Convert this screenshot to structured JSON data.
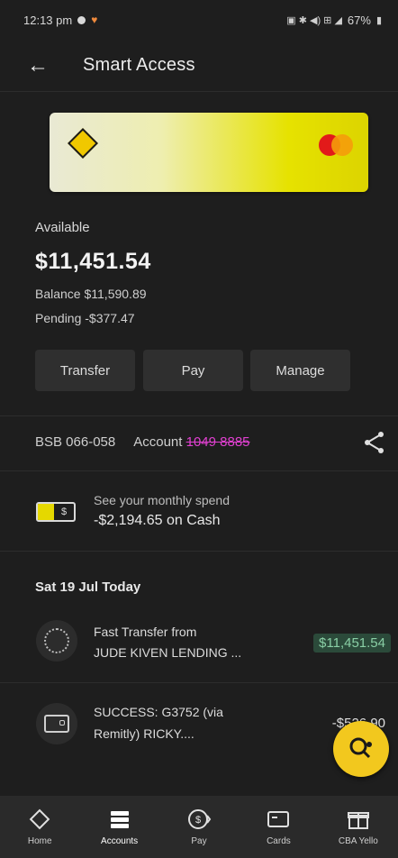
{
  "status_bar": {
    "time": "12:13 pm",
    "battery": "67%"
  },
  "header": {
    "title": "Smart Access"
  },
  "account": {
    "available_label": "Available",
    "available_amount": "$11,451.54",
    "balance_text": "Balance $11,590.89",
    "pending_text": "Pending -$377.47",
    "bsb_text": "BSB 066-058",
    "account_label": "Account",
    "account_number": "1049 8885"
  },
  "actions": {
    "transfer": "Transfer",
    "pay": "Pay",
    "manage": "Manage"
  },
  "spend": {
    "line1": "See your monthly spend",
    "line2": "-$2,194.65 on Cash"
  },
  "transactions_header": "Sat 19 Jul Today",
  "transactions": [
    {
      "line1": "Fast Transfer from",
      "line2": "JUDE KIVEN LENDING ...",
      "amount": "$11,451.54"
    },
    {
      "line1": "SUCCESS: G3752 (via",
      "line2": "Remitly) RICKY....",
      "amount": "-$526.90"
    }
  ],
  "bottom_nav": [
    {
      "label": "Home",
      "icon": "home-icon"
    },
    {
      "label": "Accounts",
      "icon": "accounts-icon"
    },
    {
      "label": "Pay",
      "icon": "pay-icon"
    },
    {
      "label": "Cards",
      "icon": "cards-icon"
    },
    {
      "label": "CBA Yello",
      "icon": "gift-icon"
    }
  ],
  "colors": {
    "accent": "#f2c81e",
    "background": "#1e1e1e",
    "positive": "#8ad0a6",
    "masked": "#e040d0"
  }
}
